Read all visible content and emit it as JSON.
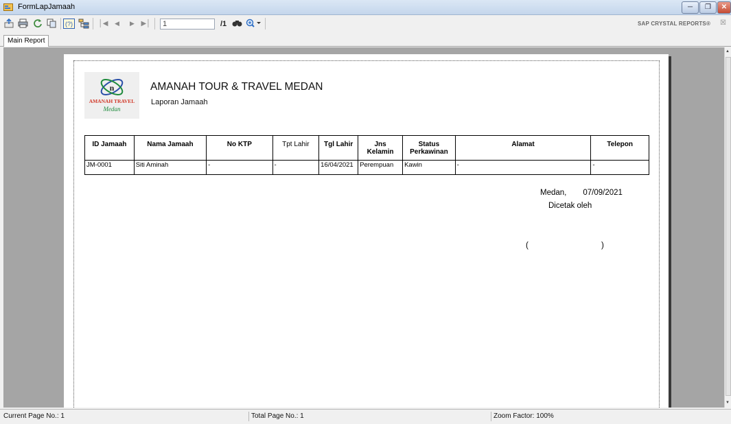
{
  "window": {
    "title": "FormLapJamaah"
  },
  "toolbar": {
    "page_value": "1",
    "page_total": "/1",
    "brand": "SAP CRYSTAL REPORTS®",
    "icons": [
      "export-icon",
      "print-icon",
      "refresh-icon",
      "copy-icon",
      "help-icon",
      "group-tree-icon",
      "first-page-icon",
      "previous-page-icon",
      "next-page-icon",
      "last-page-icon",
      "find-icon",
      "zoom-icon"
    ]
  },
  "tabs": {
    "main": "Main Report"
  },
  "report": {
    "logo_text": "AMANAH TRAVEL",
    "logo_subtext": "Medan",
    "company": "AMANAH TOUR & TRAVEL MEDAN",
    "subtitle": "Laporan Jamaah",
    "columns": [
      "ID Jamaah",
      "Nama Jamaah",
      "No KTP",
      "Tpt Lahir",
      "Tgl Lahir",
      "Jns Kelamin",
      "Status Perkawinan",
      "Alamat",
      "Telepon"
    ],
    "rows": [
      [
        "JM-0001",
        "Siti Aminah",
        "-",
        "-",
        "16/04/2021",
        "Perempuan",
        "Kawin",
        "-",
        "-"
      ]
    ],
    "place": "Medan,",
    "date": "07/09/2021",
    "signer_label": "Dicetak oleh",
    "paren_open": "(",
    "paren_close": ")"
  },
  "status": {
    "current_page": "Current Page No.: 1",
    "total_page": "Total Page No.: 1",
    "zoom": "Zoom Factor: 100%"
  },
  "colors": {
    "title_bar": "#c4d6ec",
    "viewport": "#a5a5a5",
    "close_button": "#c44b33",
    "logo_red": "#d23a2a",
    "logo_green": "#1e8a3c"
  }
}
